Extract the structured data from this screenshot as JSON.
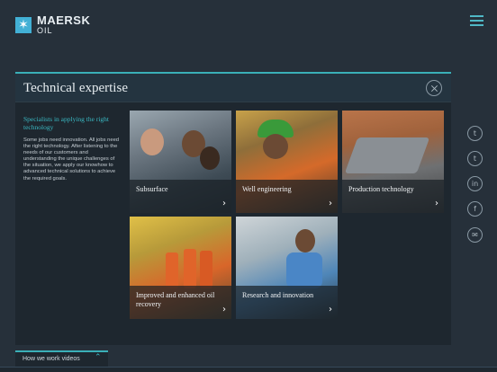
{
  "brand": {
    "line1": "MAERSK",
    "line2": "OIL",
    "logo_icon": "seven-point-star-icon",
    "accent_color": "#3ab0b8"
  },
  "menu": {
    "icon": "hamburger-menu-icon"
  },
  "panel": {
    "title": "Technical expertise",
    "close_icon": "close-circle-icon",
    "intro_heading": "Specialists in applying the right technology",
    "intro_body": "Some jobs need innovation. All jobs need the right technology. After listening to the needs of our customers and understanding the unique challenges of the situation, we apply our knowhow to advanced technical solutions to achieve the required goals.",
    "tiles": [
      {
        "label": "Subsurface",
        "icon": "chevron-right-icon"
      },
      {
        "label": "Well engineering",
        "icon": "chevron-right-icon"
      },
      {
        "label": "Production technology",
        "icon": "chevron-right-icon"
      },
      {
        "label": "Improved and enhanced oil recovery",
        "icon": "chevron-right-icon"
      },
      {
        "label": "Research and innovation",
        "icon": "chevron-right-icon"
      }
    ]
  },
  "social": [
    {
      "name": "twitter-icon",
      "glyph": "t"
    },
    {
      "name": "tumblr-icon",
      "glyph": "t"
    },
    {
      "name": "linkedin-icon",
      "glyph": "in"
    },
    {
      "name": "facebook-icon",
      "glyph": "f"
    },
    {
      "name": "email-icon",
      "glyph": "✉"
    }
  ],
  "footer": {
    "label": "How we work videos",
    "icon": "chevron-up-icon"
  }
}
